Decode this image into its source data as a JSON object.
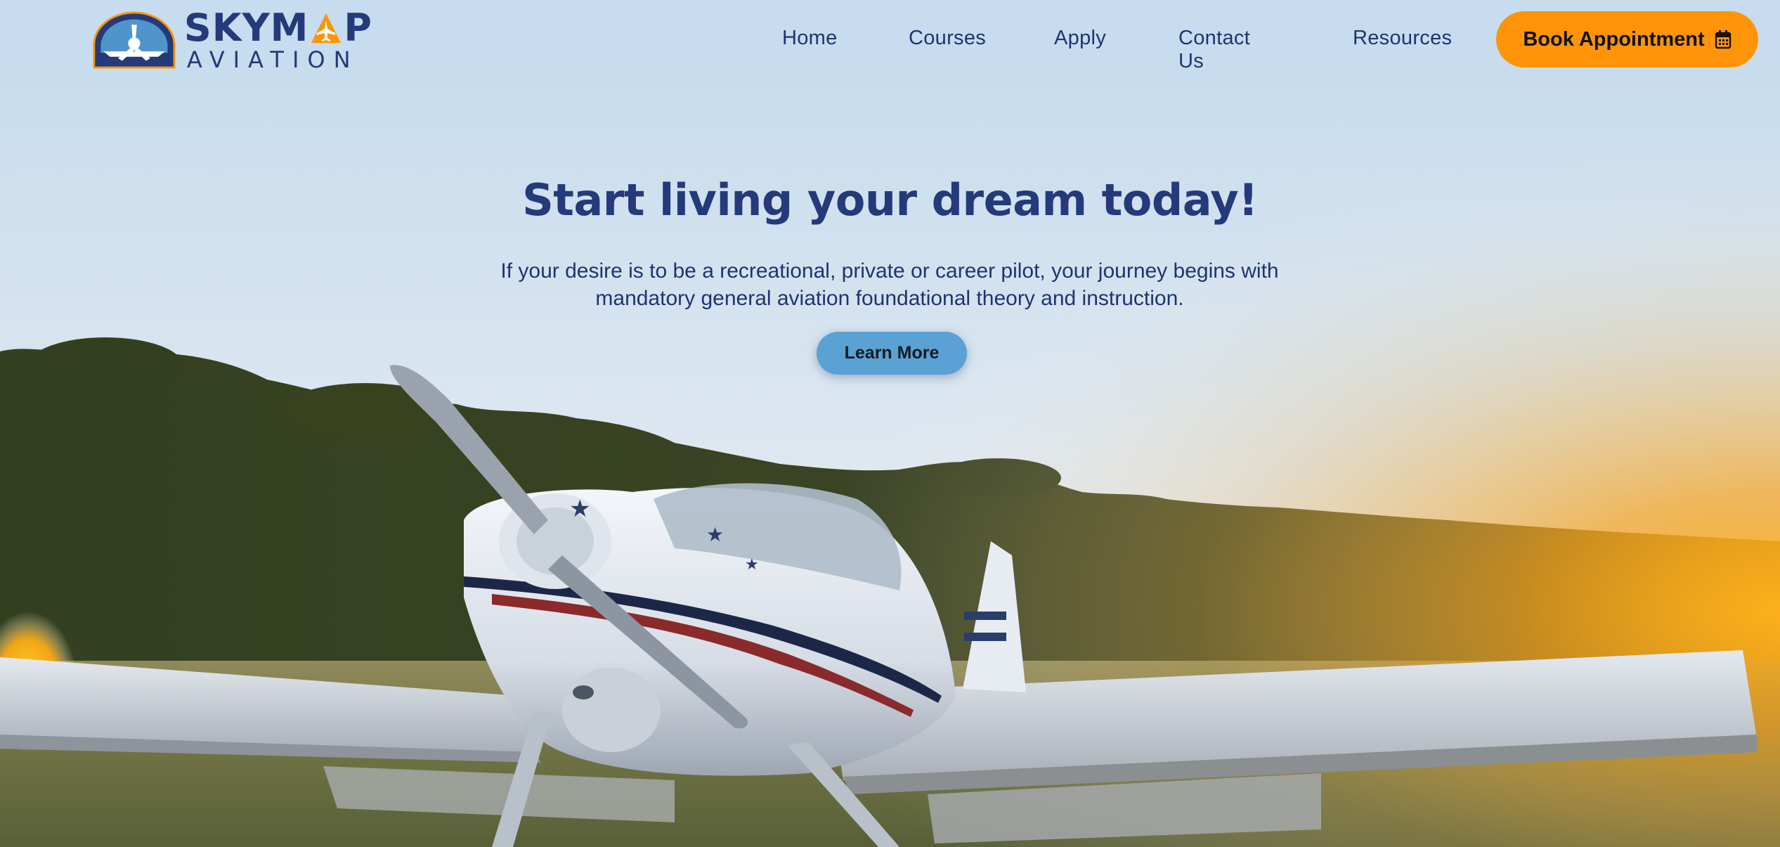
{
  "brand": {
    "name_top": "SKYMAP",
    "name_top_start": "SKYM",
    "name_top_end": "P",
    "name_bottom": "AVIATION",
    "colors": {
      "navy": "#243a7a",
      "orange": "#ff9408",
      "light_blue": "#5aa1d4"
    }
  },
  "nav": {
    "items": [
      {
        "label": "Home"
      },
      {
        "label": "Courses"
      },
      {
        "label": "Apply"
      },
      {
        "label": "Contact Us"
      },
      {
        "label": "Resources"
      }
    ],
    "cta": {
      "label": "Book Appointment",
      "icon": "calendar-icon"
    }
  },
  "hero": {
    "title": "Start living your dream today!",
    "subtitle": "If your desire is to be a recreational, private or career pilot, your journey begins with mandatory general aviation foundational theory and instruction.",
    "button_label": "Learn More"
  }
}
